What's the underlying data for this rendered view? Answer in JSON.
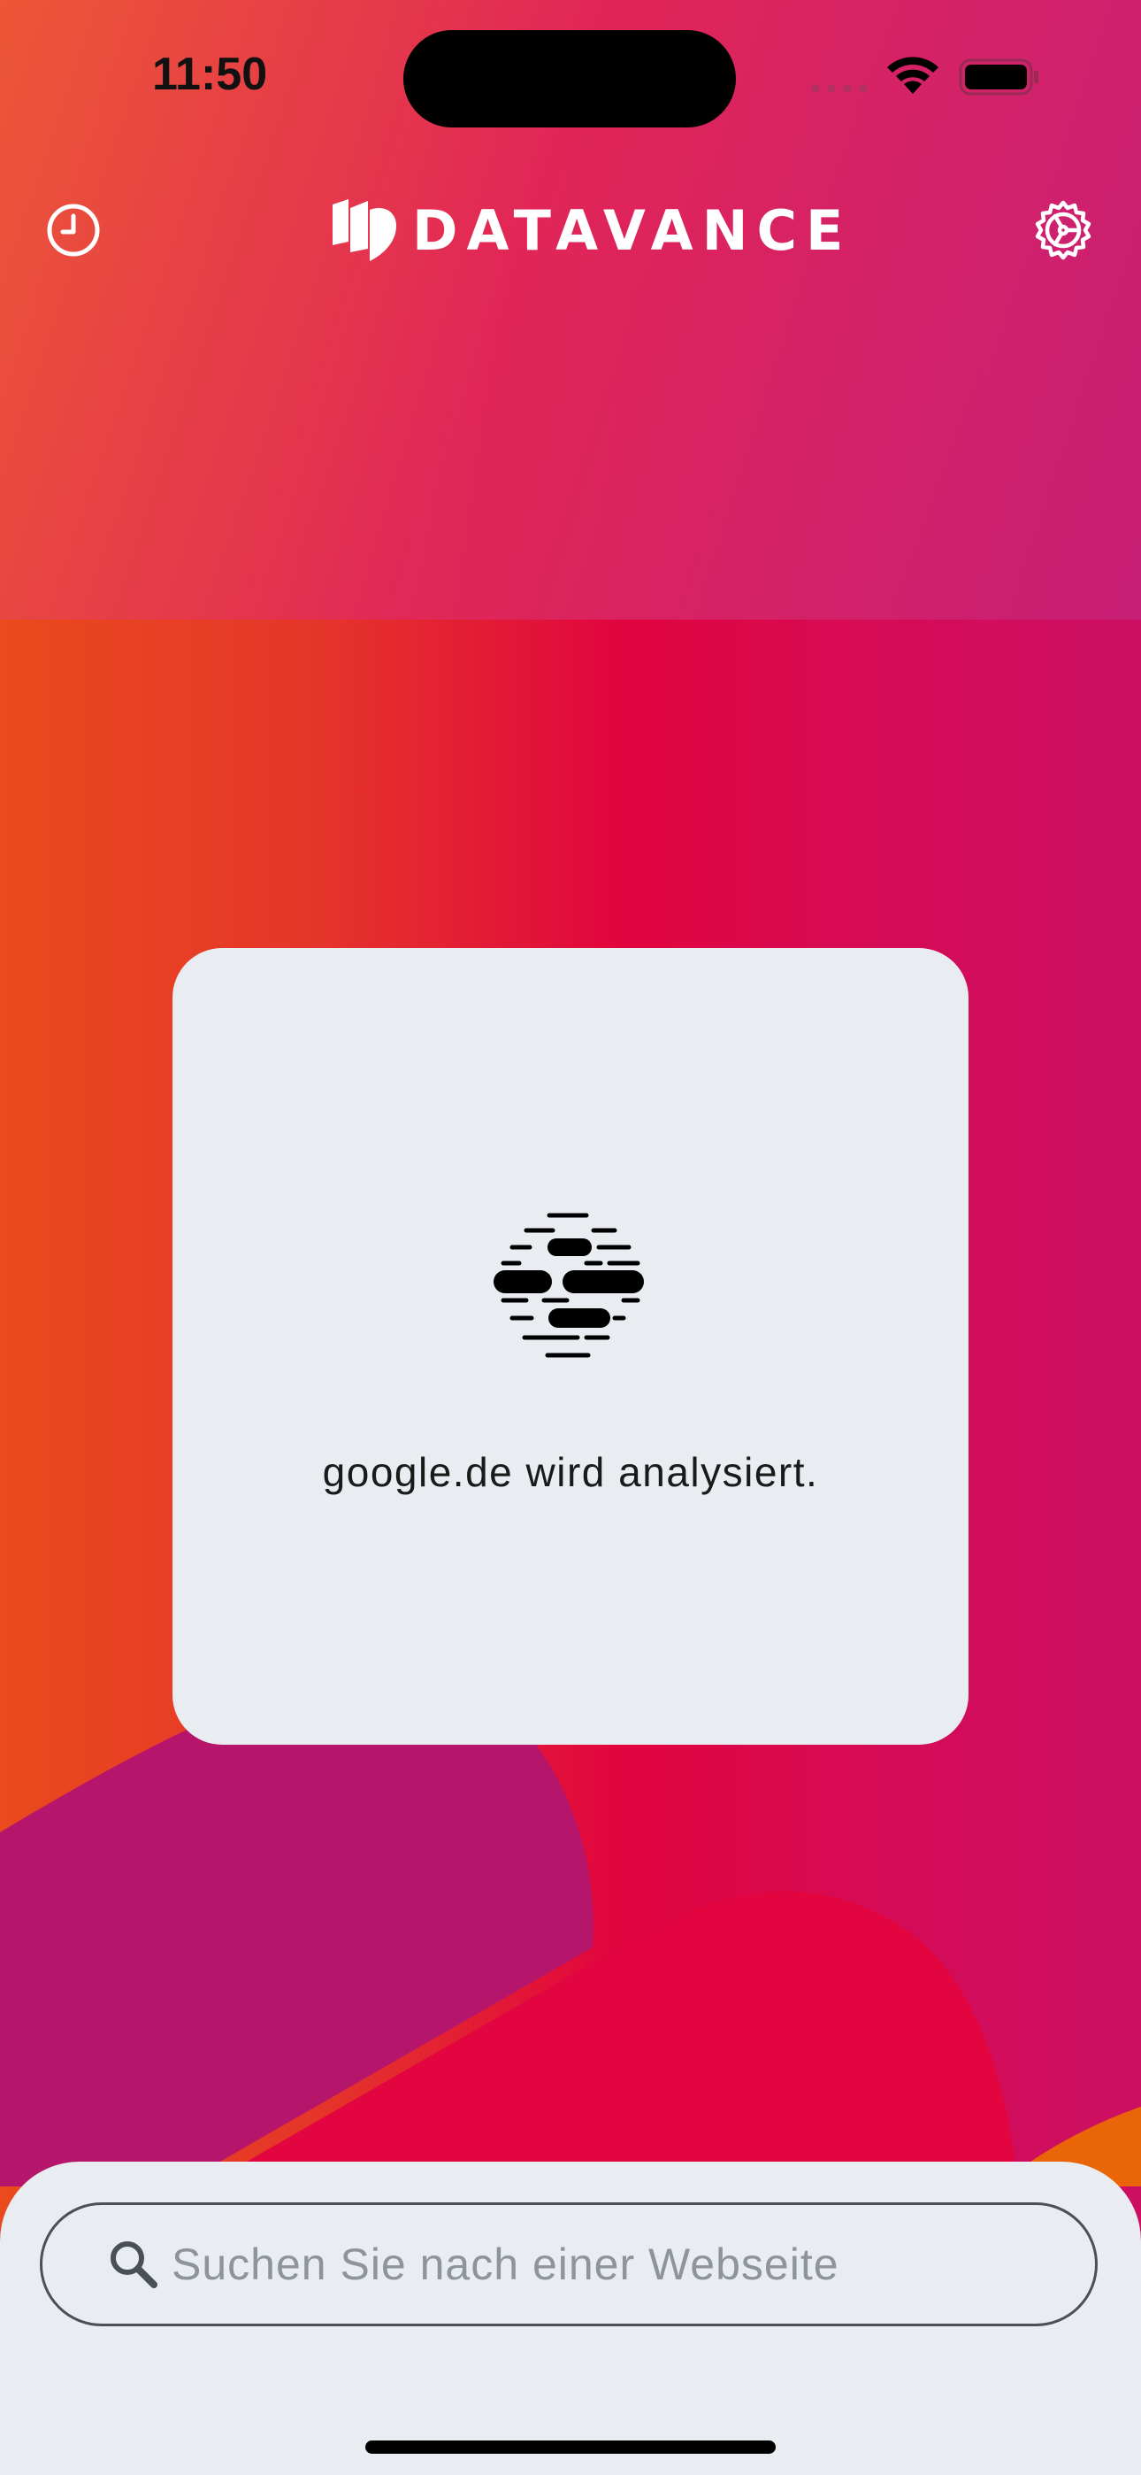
{
  "status_bar": {
    "time": "11:50",
    "icons": [
      "cellular-icon",
      "wifi-icon",
      "battery-icon"
    ]
  },
  "header": {
    "left_icon": "history-clock-icon",
    "brand": "DATAVANCE",
    "right_icon": "settings-gear-icon"
  },
  "card": {
    "loader_icon": "analyzing-loader-icon",
    "message": "google.de wird analysiert."
  },
  "search": {
    "icon": "search-icon",
    "placeholder": "Suchen Sie nach einer Webseite",
    "value": ""
  },
  "colors": {
    "gradient_left": "#ea4a1d",
    "gradient_mid": "#e1043f",
    "gradient_right": "#cc0e62",
    "card_bg": "#e9edf1",
    "text_dark": "#1a1a1a",
    "placeholder": "#8e949b"
  }
}
